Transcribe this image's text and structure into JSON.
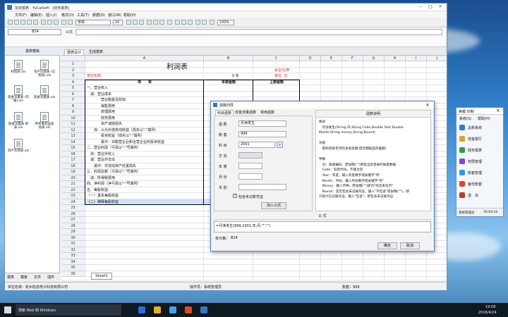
{
  "window": {
    "title": "友财报表 - YuCaiSoft - [财务报表]"
  },
  "menu": [
    "文件(F)",
    "编辑(E)",
    "插入(I)",
    "格式(O)",
    "工具(T)",
    "数据(D)",
    "窗口(W)",
    "帮助(H)"
  ],
  "toolbar": {
    "font_size": "10",
    "font_name": "宋体",
    "zoom": "100%"
  },
  "formula_bar": {
    "cell_ref": "B24",
    "fx_label": "公式"
  },
  "left_pane": {
    "header": "报表模板",
    "files": [
      {
        "name": "利润表.xls"
      },
      {
        "name": "资产负债表 (已完成).xls"
      },
      {
        "name": "现金流量表 (年报).xls"
      },
      {
        "name": "现金流量表.xls"
      },
      {
        "name": "现金流量表 附表.xls"
      },
      {
        "name": "所有者权益变 动表.xls"
      },
      {
        "name": "资产负债表.xls"
      }
    ],
    "tabs": [
      "报表",
      "模板",
      "文件",
      "插件"
    ]
  },
  "sheet_tabs": [
    "报表设计",
    "生成报表"
  ],
  "grid": {
    "columns": [
      "A",
      "B",
      "C",
      "D",
      "E",
      "F",
      "G",
      "H",
      "I",
      "J"
    ],
    "rows": [
      "1",
      "2",
      "3",
      "4",
      "5",
      "6",
      "7",
      "8",
      "9",
      "10",
      "11",
      "12",
      "13",
      "14",
      "15",
      "16",
      "17",
      "18",
      "19",
      "20",
      "21",
      "22",
      "23",
      "24",
      "25",
      "26",
      "27",
      "28",
      "29",
      "30",
      "31",
      "32",
      "33",
      "34",
      "35",
      "36"
    ],
    "selected_row": "24",
    "title": "利润表",
    "unit_label": "单位名称:",
    "year_label": "0 年",
    "report_code": "会企02表",
    "currency_label": "单位: 元",
    "header_item": "项　　目",
    "header_current": "本期金额",
    "header_prev": "上期金额",
    "items": [
      "一、营业收入",
      "　减：营业成本",
      "　　　　营业税金及附加",
      "　　　　销售费用",
      "　　　　管理费用",
      "　　　　财务费用",
      "　　　　资产减值损失",
      "　　加：公允价值变动收益（损失以\"-\"填列）",
      "　　　　投资收益（损失以\"-\"填列）",
      "　　　　其中：对联营企业和合营企业的投资收益",
      "二、营业利润（亏损以\"-\"号填列）",
      "　加：营业外收入",
      "　减：营业外支出",
      "　　其中：非流动资产处置损失",
      "三、利润总额（亏损以\"-\"号填列）",
      "　减：所得税费用",
      "四、净利润（净亏损以\"-\"号填列）",
      "五、每股收益:",
      "（一）基本每股收益",
      "（二）稀释每股收益"
    ],
    "sheet_name": "Sheet1"
  },
  "status": {
    "company": "单位名称：杭州信息电子科技有限公司",
    "operator": "操作员：系统管理员",
    "year": "账套：999"
  },
  "dialog": {
    "title": "函数向导",
    "tabs": [
      "科目函数",
      "现金流量函数",
      "常用函数"
    ],
    "fields": [
      {
        "label": "函 数",
        "value": "月净发生"
      },
      {
        "label": "账 套",
        "value": "999"
      },
      {
        "label": "科 目",
        "value": "2001"
      },
      {
        "label": "方 向",
        "value": ""
      },
      {
        "label": "年 度",
        "value": ""
      },
      {
        "label": "月 份",
        "value": ""
      },
      {
        "label": "币 别",
        "value": ""
      }
    ],
    "checkbox": "包含未记账凭证",
    "insert_button": "加入公式",
    "desc_title": "函数说明",
    "desc_lines": [
      "格式",
      "　月净发生(String Zt,String Code,Double Year,Double",
      "Month,String money,String Bound)",
      "",
      "功能",
      "　取科目某年月的净发生额(借贷相抵后的差额)",
      "",
      "参数",
      "　Zt：账套编码，若省略(\"\")即取当前登录的账套数据",
      "　Code：科目代码，不能为空",
      "　Year：年度，输入年度数字或关键字\"年\"",
      "　Month：月份，输入月份数字或关键字\"月\"",
      "　Money：输入币种，若省略(\"\")即为\"综合本位币\"",
      "　Bound：是否包含未记账凭证，输入\"不包含\"或省略(\"\")，即",
      "只统计已记账凭证；输入\"包含\"，即包含未记账凭证"
    ],
    "formula_title": "公 式",
    "formula": "=月净发生(999,2001,年,月,\"\",\"\")",
    "cell_label": "单元格：",
    "cell_value": "B24",
    "ok": "确定",
    "cancel": "取消"
  },
  "side_window": {
    "title": "荣都 印制",
    "menu": [
      "系统(S)",
      "帮助(H)"
    ],
    "items": [
      "总账系统",
      "现金银行",
      "财务报表",
      "权限管理",
      "账套管理",
      "备份账套",
      "退　出"
    ],
    "status_left": "系统管理员",
    "status_right": "16-04-24",
    "colors": [
      "#2b7bd8",
      "#d8a62b",
      "#2ba04a",
      "#7a4ad8",
      "#2b9ed8",
      "#d84a2b",
      "#c0392b"
    ]
  },
  "taskbar": {
    "search": "搜索 Web 和 Windows",
    "time": "19:08",
    "date": "2016/4/24"
  }
}
